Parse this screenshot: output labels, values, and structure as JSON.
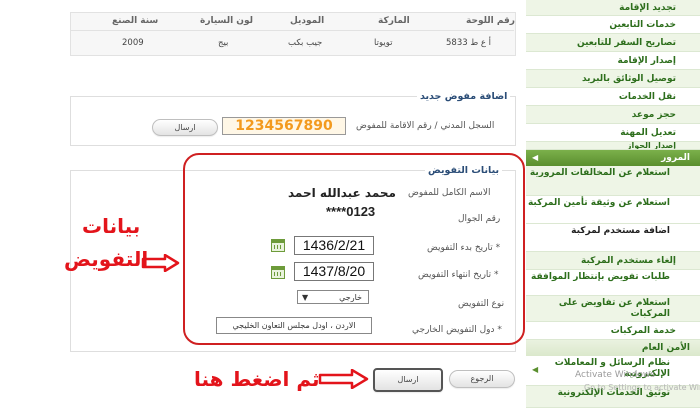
{
  "sidebar": {
    "items": [
      {
        "label": "تجديد الإقامة"
      },
      {
        "label": "خدمات التابعين"
      },
      {
        "label": "تصاريح السفر للتابعين"
      },
      {
        "label": "إصدار الإقامة"
      },
      {
        "label": "توصيل الوثائق بالبريد"
      },
      {
        "label": "نقل الخدمات"
      },
      {
        "label": "حجز موعد"
      },
      {
        "label": "تعديل المهنة"
      },
      {
        "label": "إصدار الجواز"
      }
    ],
    "section_traffic": "المرور",
    "traffic_items": [
      {
        "label": "استعلام عن المخالفات المرورية"
      },
      {
        "label": "استعلام عن وثيقة تأمين المركبة"
      },
      {
        "label": "اضافة مستخدم لمركبة"
      },
      {
        "label": "إلغاء مستخدم المركبة"
      },
      {
        "label": "طلبات تفويض بإنتظار الموافقة"
      },
      {
        "label": "استعلام عن تفاويض على المركبات"
      },
      {
        "label": "خدمة المركبات"
      }
    ],
    "section_security": "الأمن العام",
    "security_items": [
      {
        "label": "نظام الرسائل و المعاملات الإلكترونية"
      },
      {
        "label": "توثيق الخدمات الإلكترونية"
      }
    ]
  },
  "vehicle_table": {
    "headers": [
      "رقم اللوحة",
      "الماركة",
      "الموديل",
      "لون السيارة",
      "سنة الصنع"
    ],
    "row": [
      "أ ع ط 5833",
      "تويوتا",
      "جيب بكب",
      "بيج",
      "2009"
    ]
  },
  "add_delegate": {
    "title": "اضافة مفوض جديد",
    "id_label": "السجل المدني / رقم الاقامة للمفوض",
    "id_value": "1234567890",
    "send_label": "ارسال"
  },
  "delegation": {
    "title": "بيانات التفويض",
    "name_label": "الاسم الكامل للمفوض",
    "name_value": "محمد عبدالله احمد",
    "mobile_label": "رقم الجوال",
    "mobile_value": "****0123",
    "start_label": "تاريخ بدء التفويض *",
    "start_value": "1436/2/21",
    "end_label": "تاريخ انتهاء التفويض *",
    "end_value": "1437/8/20",
    "type_label": "نوع التفويض",
    "type_value": "خارجي",
    "ext_label": "دول التفويض الخارجي *",
    "ext_value": "الاردن ، اودل مجلس التعاون الخليجي"
  },
  "buttons": {
    "send": "ارسال",
    "back": "الرجوع"
  },
  "annotations": {
    "delegation_data_line1": "بيانات",
    "delegation_data_line2": "التفويض",
    "press_here": "ثم اضغط هنا",
    "color": "#e3141b"
  },
  "watermark": {
    "line1": "Activate Windows",
    "line2": "Go to Settings to activate Windo"
  },
  "colors": {
    "accent_green": "#5a8f2e",
    "title_blue": "#2b4d77",
    "id_orange": "#f39a1e",
    "frame_red": "#cf2021"
  }
}
